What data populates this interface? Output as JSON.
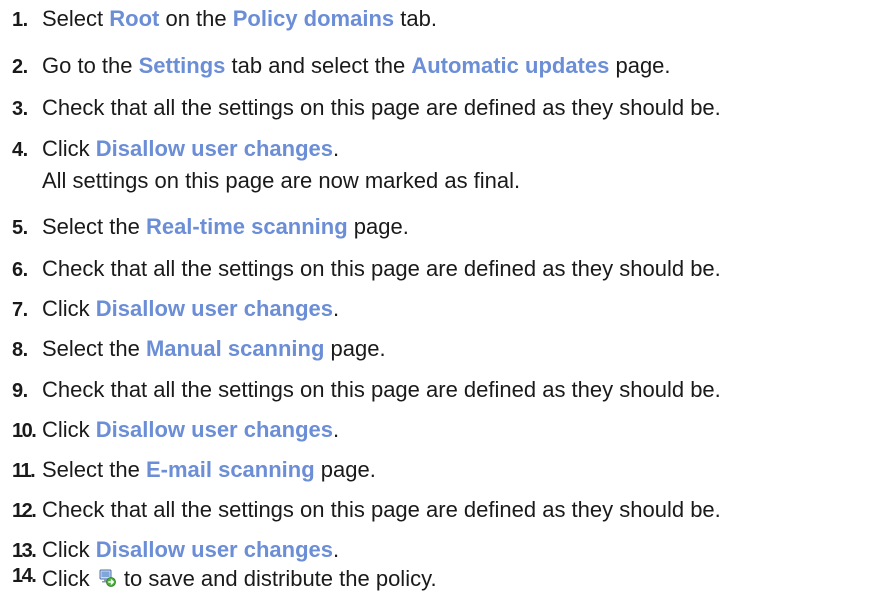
{
  "steps": [
    {
      "num": "1.",
      "parts": [
        {
          "t": "Select "
        },
        {
          "t": "Root",
          "ui": true
        },
        {
          "t": " on the "
        },
        {
          "t": "Policy domains",
          "ui": true
        },
        {
          "t": " tab."
        }
      ]
    },
    {
      "num": "2.",
      "parts": [
        {
          "t": "Go to the "
        },
        {
          "t": "Settings",
          "ui": true
        },
        {
          "t": " tab and select the "
        },
        {
          "t": "Automatic updates",
          "ui": true
        },
        {
          "t": " page."
        }
      ]
    },
    {
      "num": "3.",
      "parts": [
        {
          "t": "Check that all the settings on this page are defined as they should be."
        }
      ]
    },
    {
      "num": "4.",
      "parts": [
        {
          "t": "Click "
        },
        {
          "t": "Disallow user changes",
          "ui": true
        },
        {
          "t": "."
        }
      ],
      "sub": "All settings on this page are now marked as final."
    },
    {
      "num": "5.",
      "parts": [
        {
          "t": "Select the "
        },
        {
          "t": "Real-time scanning",
          "ui": true
        },
        {
          "t": " page."
        }
      ]
    },
    {
      "num": "6.",
      "parts": [
        {
          "t": "Check that all the settings on this page are defined as they should be."
        }
      ]
    },
    {
      "num": "7.",
      "parts": [
        {
          "t": "Click "
        },
        {
          "t": "Disallow user changes",
          "ui": true
        },
        {
          "t": "."
        }
      ]
    },
    {
      "num": "8.",
      "parts": [
        {
          "t": "Select the "
        },
        {
          "t": "Manual scanning",
          "ui": true
        },
        {
          "t": " page."
        }
      ]
    },
    {
      "num": "9.",
      "parts": [
        {
          "t": "Check that all the settings on this page are defined as they should be."
        }
      ]
    },
    {
      "num": "10.",
      "parts": [
        {
          "t": "Click "
        },
        {
          "t": "Disallow user changes",
          "ui": true
        },
        {
          "t": "."
        }
      ]
    },
    {
      "num": "11.",
      "parts": [
        {
          "t": "Select the "
        },
        {
          "t": "E-mail scanning",
          "ui": true
        },
        {
          "t": " page."
        }
      ]
    },
    {
      "num": "12.",
      "parts": [
        {
          "t": "Check that all the settings on this page are defined as they should be."
        }
      ]
    },
    {
      "num": "13.",
      "parts": [
        {
          "t": "Click "
        },
        {
          "t": "Disallow user changes",
          "ui": true
        },
        {
          "t": "."
        }
      ]
    },
    {
      "num": "14.",
      "parts": [
        {
          "t": "Click "
        },
        {
          "icon": "distribute-policy-icon"
        },
        {
          "t": " to save and distribute the policy."
        }
      ]
    }
  ],
  "colors": {
    "ui_term": "#6b8ed6",
    "text": "#1a1a1a"
  }
}
